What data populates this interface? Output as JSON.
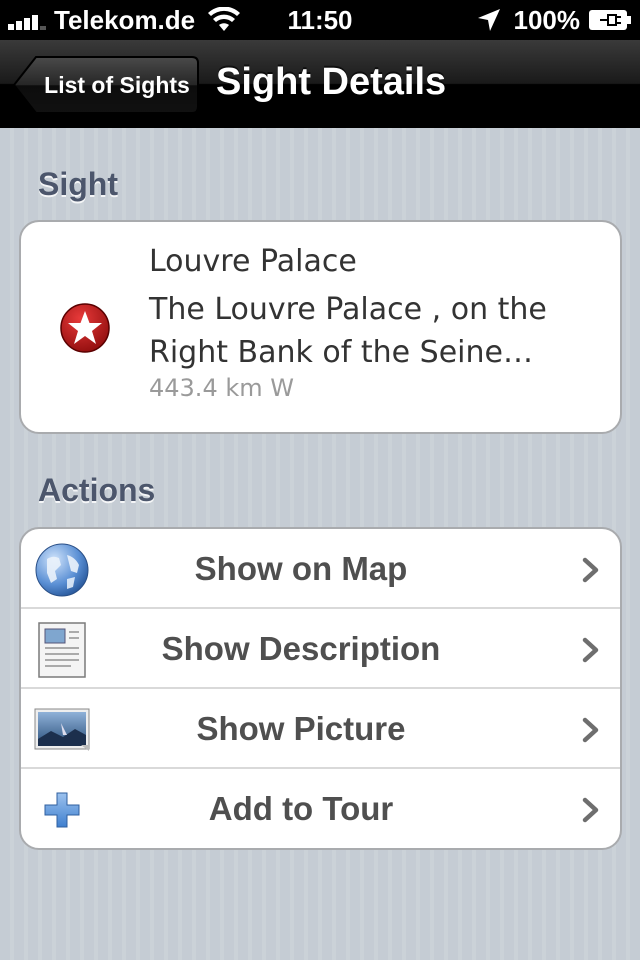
{
  "status_bar": {
    "carrier": "Telekom.de",
    "time": "11:50",
    "battery": "100%"
  },
  "nav": {
    "back_label": "List of Sights",
    "title": "Sight Details"
  },
  "sight_section": {
    "header": "Sight",
    "name": "Louvre Palace",
    "description": "The Louvre Palace , on the Right Bank of the Seine…",
    "distance": "443.4 km W",
    "icon": "star-badge-icon",
    "icon_color": "#c8102e"
  },
  "actions_section": {
    "header": "Actions",
    "items": [
      {
        "label": "Show on Map",
        "icon": "globe-icon"
      },
      {
        "label": "Show Description",
        "icon": "document-icon"
      },
      {
        "label": "Show Picture",
        "icon": "picture-icon"
      },
      {
        "label": "Add to Tour",
        "icon": "plus-icon"
      }
    ]
  }
}
